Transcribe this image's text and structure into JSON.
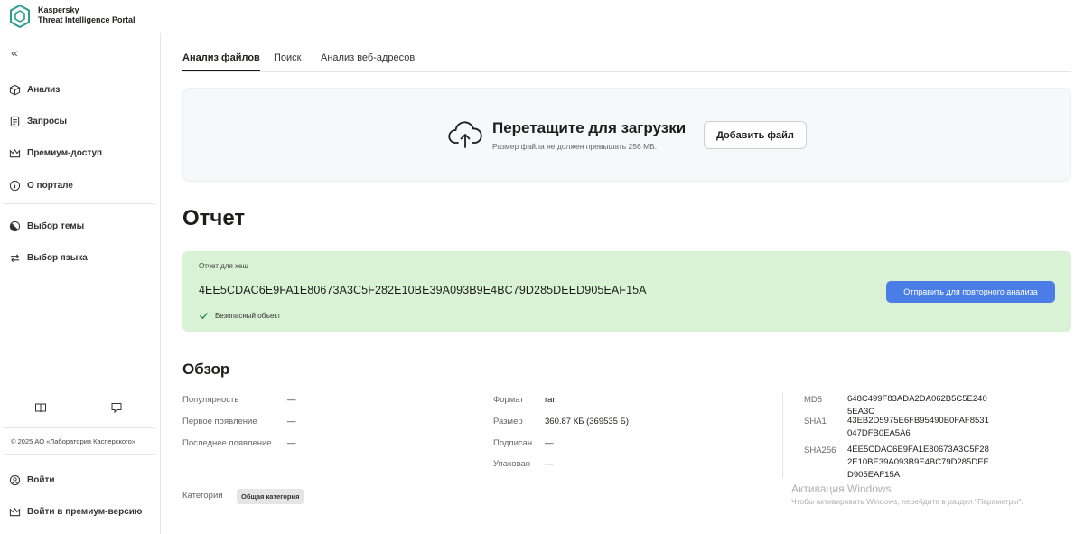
{
  "app": {
    "brand_line1": "Kaspersky",
    "brand_line2": "Threat Intelligence Portal"
  },
  "sidebar": {
    "collapse_glyph": "«",
    "items": [
      {
        "label": "Анализ",
        "icon": "cube-icon"
      },
      {
        "label": "Запросы",
        "icon": "document-icon"
      },
      {
        "label": "Премиум-доступ",
        "icon": "crown-icon"
      },
      {
        "label": "О портале",
        "icon": "info-icon"
      },
      {
        "label": "Выбор темы",
        "icon": "theme-icon"
      },
      {
        "label": "Выбор языка",
        "icon": "language-icon"
      }
    ],
    "footer_icons": [
      "book-icon",
      "chat-icon"
    ],
    "copyright": "© 2025 АО «Лаборатория Касперского»",
    "login": "Войти",
    "premium_login": "Войти в премиум-версию"
  },
  "tabs": [
    {
      "label": "Анализ файлов",
      "active": true
    },
    {
      "label": "Поиск",
      "active": false
    },
    {
      "label": "Анализ веб-адресов",
      "active": false
    }
  ],
  "upload": {
    "title": "Перетащите для загрузки",
    "subtitle": "Размер файла не должен превышать 256 МБ.",
    "button": "Добавить файл"
  },
  "report": {
    "heading": "Отчет",
    "hash_label": "Отчет для хеш",
    "hash": "4EE5CDAC6E9FA1E80673A3C5F282E10BE39A093B9E4BC79D285DEED905EAF15A",
    "status": "Безопасный объект",
    "resubmit_button": "Отправить для повторного анализа",
    "bg_color": "#d9f2d5",
    "button_color": "#4a7ee6"
  },
  "overview": {
    "heading": "Обзор",
    "col1": [
      {
        "label": "Популярность",
        "value": "—"
      },
      {
        "label": "Первое появление",
        "value": "—"
      },
      {
        "label": "Последнее появление",
        "value": "—"
      }
    ],
    "col2": [
      {
        "label": "Формат",
        "value": "rar"
      },
      {
        "label": "Размер",
        "value": "360.87 КБ (369535 Б)"
      },
      {
        "label": "Подписан",
        "value": "—"
      },
      {
        "label": "Упакован",
        "value": "—"
      }
    ],
    "col3": [
      {
        "label": "MD5",
        "value": "648C499F83ADA2DA062B5C5E2405EA3C"
      },
      {
        "label": "SHA1",
        "value": "43EB2D5975E6FB95490B0FAF8531047DFB0EA5A6"
      },
      {
        "label": "SHA256",
        "value": "4EE5CDAC6E9FA1E80673A3C5F282E10BE39A093B9E4BC79D285DEED905EAF15A"
      }
    ],
    "categories_label": "Категории",
    "category": "Общая категория"
  },
  "watermark": {
    "title": "Активация Windows",
    "subtitle": "Чтобы активировать Windows, перейдите в раздел \"Параметры\"."
  }
}
